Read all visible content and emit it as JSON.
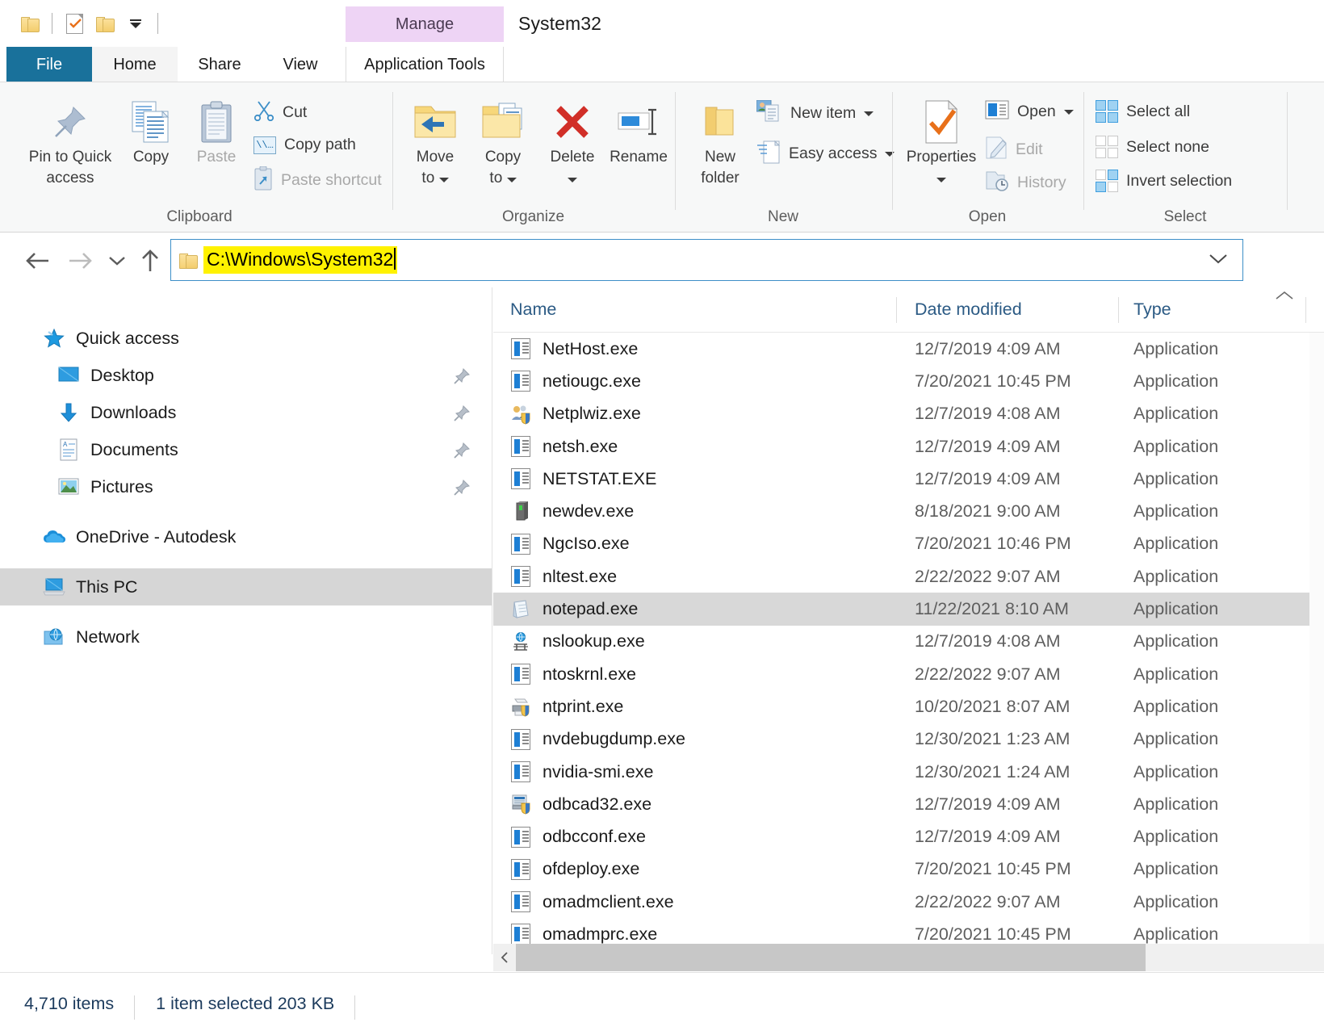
{
  "window": {
    "title": "System32",
    "contextual_tab_group": "Manage"
  },
  "quick_access_toolbar": {
    "items": [
      {
        "name": "folder-icon",
        "label": "Explorer"
      },
      {
        "name": "properties-icon",
        "label": "Properties"
      },
      {
        "name": "new-folder-icon",
        "label": "New folder"
      },
      {
        "name": "customize-caret",
        "label": "Customize Quick Access Toolbar"
      }
    ]
  },
  "tabs": [
    {
      "id": "file",
      "label": "File"
    },
    {
      "id": "home",
      "label": "Home"
    },
    {
      "id": "share",
      "label": "Share"
    },
    {
      "id": "view",
      "label": "View"
    },
    {
      "id": "apptools",
      "label": "Application Tools"
    }
  ],
  "ribbon": {
    "groups": [
      {
        "id": "clipboard",
        "label": "Clipboard",
        "big": [
          {
            "label_line1": "Pin to Quick",
            "label_line2": "access",
            "icon": "pin-icon"
          },
          {
            "label_line1": "Copy",
            "label_line2": "",
            "icon": "copy-icon"
          },
          {
            "label_line1": "Paste",
            "label_line2": "",
            "icon": "paste-icon",
            "dim": true
          }
        ],
        "small": [
          {
            "label": "Cut",
            "icon": "scissors-icon",
            "dim": false
          },
          {
            "label": "Copy path",
            "icon": "copy-path-icon",
            "dim": false
          },
          {
            "label": "Paste shortcut",
            "icon": "paste-shortcut-icon",
            "dim": true
          }
        ]
      },
      {
        "id": "organize",
        "label": "Organize",
        "big": [
          {
            "label_line1": "Move",
            "label_line2": "to",
            "icon": "move-to-icon",
            "caret": true
          },
          {
            "label_line1": "Copy",
            "label_line2": "to",
            "icon": "copy-to-icon",
            "caret": true
          },
          {
            "label_line1": "Delete",
            "label_line2": "",
            "icon": "delete-icon",
            "caret": true
          },
          {
            "label_line1": "Rename",
            "label_line2": "",
            "icon": "rename-icon"
          }
        ]
      },
      {
        "id": "new",
        "label": "New",
        "big": [
          {
            "label_line1": "New",
            "label_line2": "folder",
            "icon": "new-folder-icon"
          }
        ],
        "small": [
          {
            "label": "New item",
            "icon": "new-item-icon",
            "caret": true
          },
          {
            "label": "Easy access",
            "icon": "easy-access-icon",
            "caret": true
          }
        ]
      },
      {
        "id": "open",
        "label": "Open",
        "big": [
          {
            "label_line1": "Properties",
            "label_line2": "",
            "icon": "properties-icon",
            "caret": true
          }
        ],
        "small": [
          {
            "label": "Open",
            "icon": "open-icon",
            "caret": true,
            "dim": false
          },
          {
            "label": "Edit",
            "icon": "edit-icon",
            "dim": true
          },
          {
            "label": "History",
            "icon": "history-icon",
            "dim": true
          }
        ]
      },
      {
        "id": "select",
        "label": "Select",
        "small": [
          {
            "label": "Select all",
            "icon": "select-all-icon"
          },
          {
            "label": "Select none",
            "icon": "select-none-icon"
          },
          {
            "label": "Invert selection",
            "icon": "invert-selection-icon"
          }
        ]
      }
    ]
  },
  "address_bar": {
    "back_icon": "arrow-left-icon",
    "forward_icon": "arrow-right-icon",
    "recent_icon": "chevron-down-icon",
    "up_icon": "arrow-up-icon",
    "path": "C:\\Windows\\System32",
    "highlight_color": "#fff200",
    "dropdown_icon": "chevron-down-icon"
  },
  "nav_pane": {
    "items": [
      {
        "label": "Quick access",
        "icon": "star-icon",
        "indent": 0,
        "pinned": false,
        "selected": false
      },
      {
        "label": "Desktop",
        "icon": "desktop-icon",
        "indent": 1,
        "pinned": true,
        "selected": false
      },
      {
        "label": "Downloads",
        "icon": "download-icon",
        "indent": 1,
        "pinned": true,
        "selected": false
      },
      {
        "label": "Documents",
        "icon": "document-icon",
        "indent": 1,
        "pinned": true,
        "selected": false
      },
      {
        "label": "Pictures",
        "icon": "pictures-icon",
        "indent": 1,
        "pinned": true,
        "selected": false
      },
      {
        "label": "OneDrive - Autodesk",
        "icon": "onedrive-icon",
        "indent": 0,
        "pinned": false,
        "selected": false
      },
      {
        "label": "This PC",
        "icon": "this-pc-icon",
        "indent": 0,
        "pinned": false,
        "selected": true
      },
      {
        "label": "Network",
        "icon": "network-icon",
        "indent": 0,
        "pinned": false,
        "selected": false
      }
    ]
  },
  "file_list": {
    "columns": [
      "Name",
      "Date modified",
      "Type"
    ],
    "rows": [
      {
        "name": "NetHost.exe",
        "date": "12/7/2019 4:09 AM",
        "type": "Application",
        "icon": "exe-icon",
        "selected": false
      },
      {
        "name": "netiougc.exe",
        "date": "7/20/2021 10:45 PM",
        "type": "Application",
        "icon": "exe-icon",
        "selected": false
      },
      {
        "name": "Netplwiz.exe",
        "date": "12/7/2019 4:08 AM",
        "type": "Application",
        "icon": "users-icon",
        "selected": false
      },
      {
        "name": "netsh.exe",
        "date": "12/7/2019 4:09 AM",
        "type": "Application",
        "icon": "exe-icon",
        "selected": false
      },
      {
        "name": "NETSTAT.EXE",
        "date": "12/7/2019 4:09 AM",
        "type": "Application",
        "icon": "exe-icon",
        "selected": false
      },
      {
        "name": "newdev.exe",
        "date": "8/18/2021 9:00 AM",
        "type": "Application",
        "icon": "device-icon",
        "selected": false
      },
      {
        "name": "NgcIso.exe",
        "date": "7/20/2021 10:46 PM",
        "type": "Application",
        "icon": "exe-icon",
        "selected": false
      },
      {
        "name": "nltest.exe",
        "date": "2/22/2022 9:07 AM",
        "type": "Application",
        "icon": "exe-icon",
        "selected": false
      },
      {
        "name": "notepad.exe",
        "date": "11/22/2021 8:10 AM",
        "type": "Application",
        "icon": "notepad-icon",
        "selected": true
      },
      {
        "name": "nslookup.exe",
        "date": "12/7/2019 4:08 AM",
        "type": "Application",
        "icon": "globe-icon",
        "selected": false
      },
      {
        "name": "ntoskrnl.exe",
        "date": "2/22/2022 9:07 AM",
        "type": "Application",
        "icon": "exe-icon",
        "selected": false
      },
      {
        "name": "ntprint.exe",
        "date": "10/20/2021 8:07 AM",
        "type": "Application",
        "icon": "printer-icon",
        "selected": false
      },
      {
        "name": "nvdebugdump.exe",
        "date": "12/30/2021 1:23 AM",
        "type": "Application",
        "icon": "exe-icon",
        "selected": false
      },
      {
        "name": "nvidia-smi.exe",
        "date": "12/30/2021 1:24 AM",
        "type": "Application",
        "icon": "exe-icon",
        "selected": false
      },
      {
        "name": "odbcad32.exe",
        "date": "12/7/2019 4:09 AM",
        "type": "Application",
        "icon": "odbc-icon",
        "selected": false
      },
      {
        "name": "odbcconf.exe",
        "date": "12/7/2019 4:09 AM",
        "type": "Application",
        "icon": "exe-icon",
        "selected": false
      },
      {
        "name": "ofdeploy.exe",
        "date": "7/20/2021 10:45 PM",
        "type": "Application",
        "icon": "exe-icon",
        "selected": false
      },
      {
        "name": "omadmclient.exe",
        "date": "2/22/2022 9:07 AM",
        "type": "Application",
        "icon": "exe-icon",
        "selected": false
      },
      {
        "name": "omadmprc.exe",
        "date": "7/20/2021 10:45 PM",
        "type": "Application",
        "icon": "exe-icon",
        "selected": false
      }
    ]
  },
  "status_bar": {
    "item_count": "4,710 items",
    "selection": "1 item selected  203 KB"
  }
}
